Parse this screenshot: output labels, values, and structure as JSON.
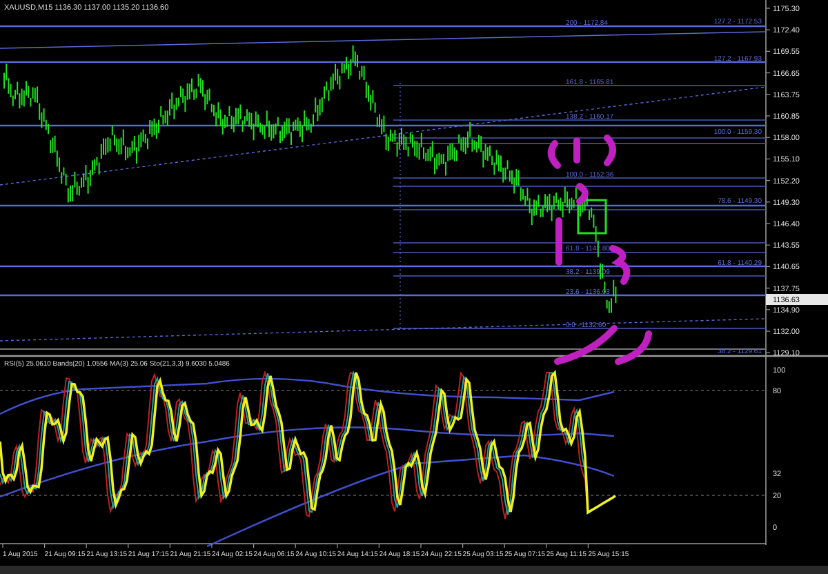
{
  "chart_header": "XAUUSD,M15  1136.30 1137.00 1135.20 1136.60",
  "price_axis": [
    "1175.30",
    "1172.40",
    "1169.55",
    "1166.65",
    "1163.75",
    "1160.85",
    "1158.00",
    "1155.10",
    "1152.20",
    "1149.30",
    "1146.40",
    "1143.55",
    "1140.65",
    "1137.75",
    "1134.90",
    "1132.00",
    "1129.10"
  ],
  "current_price": "1136.63",
  "fib_labels": [
    "200 - 1172.84",
    "127.2 - 1172.53",
    "127.2 - 1167.93",
    "161.8 - 1165.81",
    "138.2 - 1160.17",
    "100.0 - 1159.30",
    "100.0 - 1152.36",
    "78.6 - 1149.30",
    "61.8 - 1142.80",
    "61.8 - 1140.29",
    "38.2 - 1139.09",
    "23.6 - 1136.03",
    "0.0 - 1132.60",
    "38.2 - 1129.61"
  ],
  "oscillator_header": "RSI(5) 25.0610  Bands(20) 1.0556  MA(3) 25.06  Sto(21,3,3) 9.6030 5.0486",
  "oscillator_axis": [
    "100",
    "80",
    "32",
    "20",
    "0"
  ],
  "time_axis": [
    "1 Aug 2015",
    "21 Aug 09:15",
    "21 Aug 13:15",
    "21 Aug 17:15",
    "21 Aug 21:15",
    "24 Aug 02:15",
    "24 Aug 06:15",
    "24 Aug 10:15",
    "24 Aug 14:15",
    "24 Aug 18:15",
    "24 Aug 22:15",
    "25 Aug 03:15",
    "25 Aug 07:15",
    "25 Aug 11:15",
    "25 Aug 15:15"
  ]
}
